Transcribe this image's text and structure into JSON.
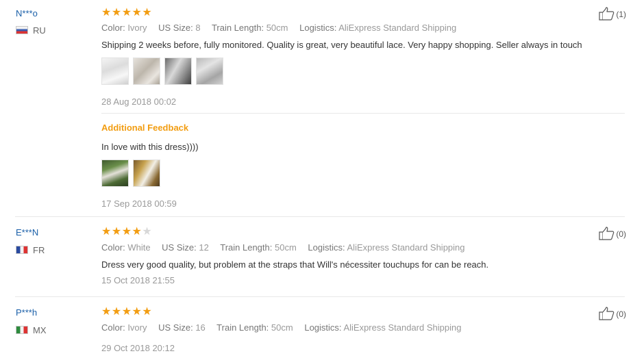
{
  "reviews": [
    {
      "user": "N***o",
      "country": "RU",
      "flag": "flag-ru",
      "stars": 5,
      "attrs": [
        {
          "k": "Color:",
          "v": "Ivory"
        },
        {
          "k": "US Size:",
          "v": "8"
        },
        {
          "k": "Train Length:",
          "v": "50cm"
        },
        {
          "k": "Logistics:",
          "v": "AliExpress Standard Shipping"
        }
      ],
      "text": "Shipping 2 weeks before, fully monitored. Quality is great, very beautiful lace. Very happy shopping. Seller always in touch",
      "date": "28 Aug 2018 00:02",
      "helpful": "(1)",
      "additional": {
        "label": "Additional Feedback",
        "text": "In love with this dress))))",
        "date": "17 Sep 2018 00:59"
      }
    },
    {
      "user": "E***N",
      "country": "FR",
      "flag": "flag-fr",
      "stars": 4,
      "attrs": [
        {
          "k": "Color:",
          "v": "White"
        },
        {
          "k": "US Size:",
          "v": "12"
        },
        {
          "k": "Train Length:",
          "v": "50cm"
        },
        {
          "k": "Logistics:",
          "v": "AliExpress Standard Shipping"
        }
      ],
      "text": "Dress very good quality, but problem at the straps that Will's nécessiter touchups for can be reach.",
      "date": "15 Oct 2018 21:55",
      "helpful": "(0)"
    },
    {
      "user": "P***h",
      "country": "MX",
      "flag": "flag-mx",
      "stars": 5,
      "attrs": [
        {
          "k": "Color:",
          "v": "Ivory"
        },
        {
          "k": "US Size:",
          "v": "16"
        },
        {
          "k": "Train Length:",
          "v": "50cm"
        },
        {
          "k": "Logistics:",
          "v": "AliExpress Standard Shipping"
        }
      ],
      "text": "",
      "date": "29 Oct 2018 20:12",
      "helpful": "(0)"
    }
  ],
  "icons": {
    "star": "★",
    "helpful": "thumbs-up-icon"
  },
  "colors": {
    "star": "#f29d12",
    "star_empty": "#d8d8d8",
    "username": "#1a5fa8",
    "additional_label": "#f29d12"
  }
}
